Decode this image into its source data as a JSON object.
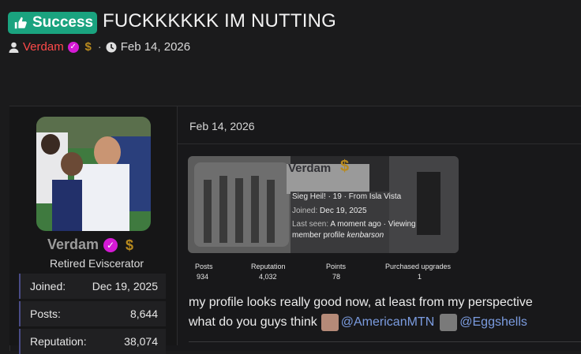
{
  "thread": {
    "prefix": "Success",
    "title": "FUCKKKKKK IM NUTTING",
    "author": "Verdam",
    "separator": "·",
    "date": "Feb 14, 2026"
  },
  "post_user": {
    "name": "Verdam",
    "title": "Retired Eviscerator",
    "stats": [
      {
        "label": "Joined:",
        "value": "Dec 19, 2025"
      },
      {
        "label": "Posts:",
        "value": "8,644"
      },
      {
        "label": "Reputation:",
        "value": "38,074"
      }
    ]
  },
  "post": {
    "date": "Feb 14, 2026",
    "embed": {
      "name": "Verdam",
      "line1": "Sieg Heil! · 19 · From Isla Vista",
      "joined_label": "Joined:",
      "joined_value": "Dec 19, 2025",
      "lastseen_label": "Last seen:",
      "lastseen_value": "A moment ago · Viewing",
      "lastseen_value2": "member profile",
      "lastseen_user": "kenbarson",
      "stats": [
        {
          "label": "Posts",
          "value": "934"
        },
        {
          "label": "Reputation",
          "value": "4,032"
        },
        {
          "label": "Points",
          "value": "78"
        },
        {
          "label": "Purchased upgrades",
          "value": "1"
        }
      ]
    },
    "line1": "my profile looks really good now, at least from my perspective",
    "line2_prefix": "what do you guys think",
    "mention1": "@AmericanMTN",
    "mention2": "@Eggshells"
  },
  "colors": {
    "accent": "#1aa37f",
    "author": "#ff4a4a",
    "mention": "#7b9ce0",
    "verified": "#d51ad5"
  },
  "icons": [
    "thumbs-up-icon",
    "user-icon",
    "verified-icon",
    "dollar-badge-icon",
    "clock-icon"
  ]
}
